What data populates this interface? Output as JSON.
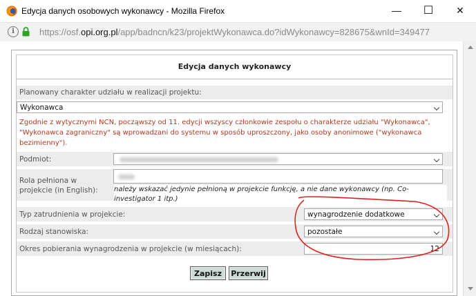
{
  "window": {
    "title": "Edycja danych osobowych wykonawcy - Mozilla Firefox",
    "minimize_glyph": "—",
    "maximize_glyph": "☐",
    "close_glyph": "✕"
  },
  "urlbar": {
    "prefix": "https://osf.",
    "domain": "opi.org.pl",
    "path": "/app/badncn/k23/projektWykonawca.do?idWykonawcy=828675&wnId=349477"
  },
  "dialog": {
    "title": "Edycja danych wykonawcy",
    "participation": {
      "label": "Planowany charakter udziału w realizacji projektu:",
      "value": "Wykonawca"
    },
    "notice": "Zgodnie z wytycznymi NCN, począwszy od 11. edycji wszyscy członkowie zespołu o charakterze udziału \"Wykonawca\", \"Wykonawca zagraniczny\" są wprowadzani do systemu w sposób uproszczony, jako osoby anonimowe (\"wykonawca bezimienny\").",
    "entity": {
      "label": "Podmiot:"
    },
    "role": {
      "label": "Rola pełniona w projekcie (in English):",
      "hint": "należy wskazać jedynie pełnioną w projekcie funkcję, a nie dane wykonawcy (np. Co-investigator 1 itp.)"
    },
    "employment": {
      "label": "Typ zatrudnienia w projekcie:",
      "value": "wynagrodzenie dodatkowe"
    },
    "position": {
      "label": "Rodzaj stanowiska:",
      "value": "pozostałe"
    },
    "period": {
      "label": "Okres pobierania wynagrodzenia w projekcie (w miesiącach):",
      "value": "12"
    },
    "buttons": {
      "save": "Zapisz",
      "cancel": "Przerwij"
    }
  },
  "colors": {
    "notice": "#b6371e",
    "annotation": "#e0201c",
    "button_bg": "#cfdbd9"
  },
  "icons": [
    "firefox-icon",
    "info-icon",
    "lock-icon",
    "chevron-down-icon"
  ]
}
